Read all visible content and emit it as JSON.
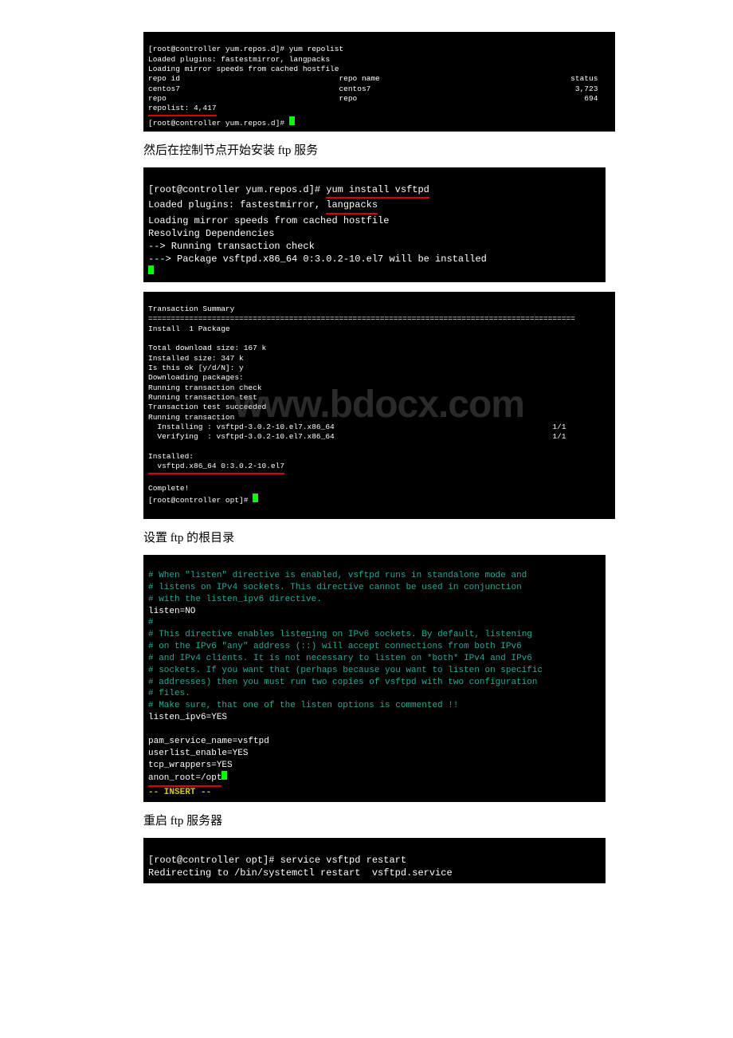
{
  "term1": {
    "l1": "[root@controller yum.repos.d]# yum repolist",
    "l2": "Loaded plugins: fastestmirror, langpacks",
    "l3": "Loading mirror speeds from cached hostfile",
    "l4": "repo id                                   repo name                                          status",
    "l5": "centos7                                   centos7                                             3,723",
    "l6": "repo                                      repo                                                  694",
    "l7": "repolist: 4,417",
    "l8": "[root@controller yum.repos.d]# "
  },
  "p1": "然后在控制节点开始安装 ftp 服务",
  "term2": {
    "l1a": "[root@controller yum.repos.d]# ",
    "l1b": "yum install vsftpd",
    "l2a": "Loaded plugins: fastestmirror, ",
    "l2b": "langpacks",
    "l3": "Loading mirror speeds from cached hostfile",
    "l4": "Resolving Dependencies",
    "l5": "--> Running transaction check",
    "l6": "---> Package vsftpd.x86_64 0:3.0.2-10.el7 will be installed"
  },
  "term3": {
    "l1": "Transaction Summary",
    "l2": "==============================================================================================",
    "l3": "Install  1 Package",
    "l4": "",
    "l5": "Total download size: 167 k",
    "l6": "Installed size: 347 k",
    "l7": "Is this ok [y/d/N]: y",
    "l8": "Downloading packages:",
    "l9": "Running transaction check",
    "l10": "Running transaction test",
    "l11": "Transaction test succeeded",
    "l12": "Running transaction",
    "l13": "  Installing : vsftpd-3.0.2-10.el7.x86_64                                                1/1",
    "l14": "  Verifying  : vsftpd-3.0.2-10.el7.x86_64                                                1/1",
    "l15": "",
    "l16": "Installed:",
    "l17": "  vsftpd.x86_64 0:3.0.2-10.el7",
    "l18": "",
    "l19": "Complete!",
    "l20": "[root@controller opt]# "
  },
  "watermark": "www.bdocx.com",
  "p2": "设置 ftp 的根目录",
  "term4": {
    "l1": "# When \"listen\" directive is enabled, vsftpd runs in standalone mode and",
    "l2": "# listens on IPv4 sockets. This directive cannot be used in conjunction",
    "l3": "# with the listen_ipv6 directive.",
    "l4": "listen=NO",
    "l5": "#",
    "l6a": "# This directive enables liste",
    "l6b": "n",
    "l6c": "ing on IPv6 sockets. By default, listening",
    "l7": "# on the IPv6 \"any\" address (::) will accept connections from both IPv6",
    "l8": "# and IPv4 clients. It is not necessary to listen on *both* IPv4 and IPv6",
    "l9": "# sockets. If you want that (perhaps because you want to listen on specific",
    "l10": "# addresses) then you must run two copies of vsftpd with two configuration",
    "l11": "# files.",
    "l12": "# Make sure, that one of the listen options is commented !!",
    "l13": "listen_ipv6=YES",
    "l14": "",
    "l15": "pam_service_name=vsftpd",
    "l16": "userlist_enable=YES",
    "l17": "tcp_wrappers=YES",
    "l18": "anon_root=/opt",
    "l19": "-- INSERT --"
  },
  "p3": "重启 ftp 服务器",
  "term5": {
    "l1": "[root@controller opt]# service vsftpd restart",
    "l2": "Redirecting to /bin/systemctl restart  vsftpd.service"
  }
}
